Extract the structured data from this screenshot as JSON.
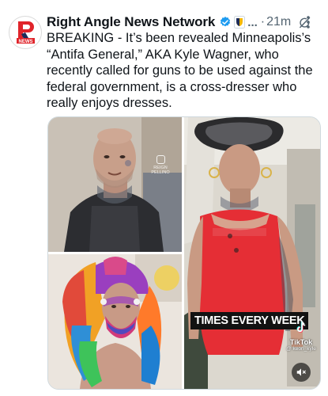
{
  "tweet": {
    "author": {
      "name": "Right Angle News Network",
      "avatar_icon": "right-angle-news-logo",
      "avatar_logo_text": "NEWS",
      "verified_color": "#1d9bf0"
    },
    "header": {
      "more_dots": "...",
      "separator": "·",
      "timestamp": "21m"
    },
    "text": "BREAKING - It’s been revealed Minneapolis’s “Antifa General,” AKA Kyle Wagner, who recently called for guns to be used against the federal government, is a cross-dresser who really enjoys dresses.",
    "media": {
      "photo1_watermark": "REIGN PELLINO",
      "video_caption": "TIMES EVERY WEEK",
      "tiktok_label": "TikTok",
      "tiktok_handle": "@ keon_kyle",
      "mute_icon": "speaker-muted-icon"
    }
  }
}
